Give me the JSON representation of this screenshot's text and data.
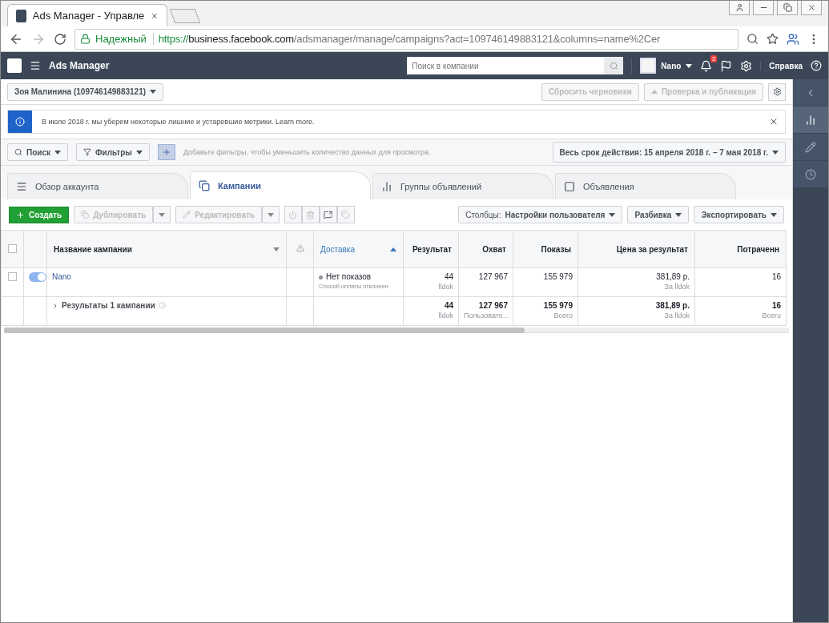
{
  "browser": {
    "tab_title": "Ads Manager - Управле",
    "security": "Надежный",
    "url": {
      "scheme": "https://",
      "host": "business.facebook.com",
      "path": "/adsmanager/manage/campaigns?act=109746149883121&columns=name%2Cer"
    }
  },
  "header": {
    "title": "Ads Manager",
    "search_placeholder": "Поиск в компании",
    "account": "Nano",
    "notifications": "2",
    "help": "Справка"
  },
  "side_rail": [
    {
      "kind": "collapse",
      "selected": false
    },
    {
      "kind": "chart",
      "selected": true
    },
    {
      "kind": "edit",
      "selected": false
    },
    {
      "kind": "history",
      "selected": false
    }
  ],
  "account_bar": {
    "account": "Зоя Малинина (109746149883121)",
    "buttons": [
      {
        "label": "Сбросить черновики",
        "disabled": true,
        "kind": "plain"
      },
      {
        "label": "Проверка и публикация",
        "disabled": true,
        "kind": "publish"
      }
    ]
  },
  "notice": {
    "text": "В июле 2018 г. мы уберем некоторые лишние и устаревшие метрики.",
    "link": "Learn more."
  },
  "filter_bar": {
    "search": "Поиск",
    "filters": "Фильтры",
    "hint": "Добавьте фильтры, чтобы уменьшить количество данных для просмотра.",
    "date_range": "Весь срок действия: 15 апреля 2018 г. – 7 мая 2018 г."
  },
  "tabs": [
    {
      "label": "Обзор аккаунта",
      "kind": "overview",
      "selected": false
    },
    {
      "label": "Кампании",
      "kind": "campaigns",
      "selected": true
    },
    {
      "label": "Группы объявлений",
      "kind": "adsets",
      "selected": false
    },
    {
      "label": "Объявления",
      "kind": "ads",
      "selected": false
    }
  ],
  "toolbar": {
    "create": "Создать",
    "duplicate": {
      "label": "Дублировать",
      "disabled": true
    },
    "edit": {
      "label": "Редактировать",
      "disabled": true
    },
    "columns_label": "Столбцы:",
    "columns_value": "Настройки пользователя",
    "breakdown": "Разбивка",
    "export": "Экспортировать"
  },
  "table": {
    "select_all_checked": false,
    "columns": [
      {
        "label": "Название кампании",
        "kind": "name",
        "sorted": false
      },
      {
        "label": "Доставка",
        "kind": "delivery",
        "sorted": true
      },
      {
        "label": "Результат",
        "kind": "num",
        "sorted": false
      },
      {
        "label": "Охват",
        "kind": "num",
        "sorted": false
      },
      {
        "label": "Показы",
        "kind": "num",
        "sorted": false
      },
      {
        "label": "Цена за результат",
        "kind": "num",
        "sorted": false
      },
      {
        "label": "Потраченн",
        "kind": "num",
        "sorted": false
      }
    ],
    "rows": [
      {
        "checked": false,
        "on": true,
        "cells": [
          {
            "value": "Nano"
          },
          {
            "value": "Нет показов",
            "note": "Способ оплаты отклонен"
          },
          {
            "value": "44",
            "note": "lldok"
          },
          {
            "value": "127 967"
          },
          {
            "value": "155 979"
          },
          {
            "value": "381,89 р.",
            "note": "За lldok"
          },
          {
            "value": "16"
          }
        ]
      }
    ],
    "summary": {
      "label": "Результаты 1 кампании",
      "metrics": [
        {
          "value": "44",
          "note": "lldok"
        },
        {
          "value": "127 967",
          "note": "Пользовате..."
        },
        {
          "value": "155 979",
          "note": "Всего"
        },
        {
          "value": "381,89 р.",
          "note": "За lldok"
        },
        {
          "value": "16",
          "note": "Всего"
        }
      ]
    }
  }
}
